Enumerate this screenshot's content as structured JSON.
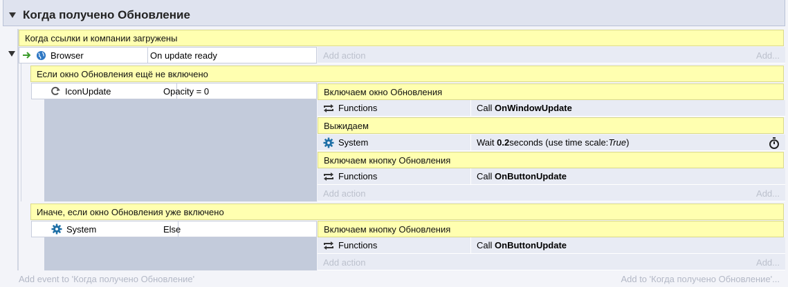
{
  "group": {
    "title": "Когда получено Обновление"
  },
  "event1": {
    "comment": "Когда ссылки и компании загружены",
    "condition": {
      "object": "Browser",
      "text": "On update ready"
    },
    "add_action": "Add action",
    "add_right": "Add..."
  },
  "sub1": {
    "comment": "Если окно Обновления ещё не включено",
    "condition": {
      "object": "IconUpdate",
      "text": "Opacity = 0"
    },
    "actions": [
      {
        "comment": "Включаем окно Обновления"
      },
      {
        "object": "Functions",
        "prefix": "Call ",
        "bold": "OnWindowUpdate"
      },
      {
        "comment": "Выжидаем"
      },
      {
        "object": "System",
        "prefix": "Wait ",
        "bold": "0.2",
        "middle": " seconds (use time scale: ",
        "italic": "True",
        "suffix": ")"
      },
      {
        "comment": "Включаем кнопку Обновления"
      },
      {
        "object": "Functions",
        "prefix": "Call ",
        "bold": "OnButtonUpdate"
      }
    ],
    "add_action": "Add action",
    "add_right": "Add..."
  },
  "sub2": {
    "comment": "Иначе, если окно Обновления уже включено",
    "condition": {
      "object": "System",
      "text": "Else"
    },
    "actions": [
      {
        "comment": "Включаем кнопку Обновления"
      },
      {
        "object": "Functions",
        "prefix": "Call ",
        "bold": "OnButtonUpdate"
      }
    ],
    "add_action": "Add action",
    "add_right": "Add..."
  },
  "footer": {
    "add_event": "Add event to 'Когда получено Обновление'",
    "add_to": "Add to 'Когда получено Обновление'..."
  },
  "colors": {
    "comment_bg": "#ffffb0",
    "action_bg": "#e8ebf4",
    "empty_bg": "#c3cbdb",
    "header_bg": "#dfe3ef"
  }
}
